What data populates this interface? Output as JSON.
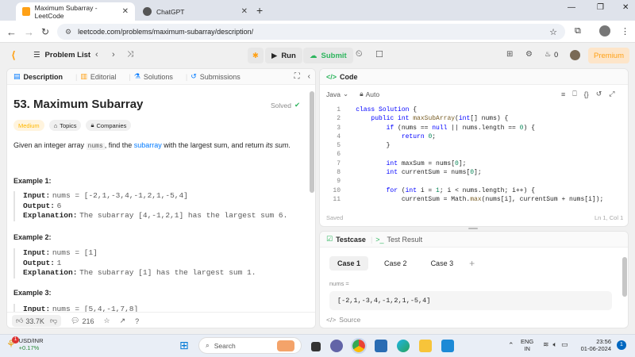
{
  "browser": {
    "tabs": [
      {
        "title": "Maximum Subarray - LeetCode",
        "active": true
      },
      {
        "title": "ChatGPT",
        "active": false
      }
    ],
    "url": "leetcode.com/problems/maximum-subarray/description/"
  },
  "nav": {
    "problem_list": "Problem List",
    "run": "Run",
    "submit": "Submit",
    "count": "0",
    "premium": "Premium"
  },
  "left_tabs": [
    "Description",
    "Editorial",
    "Solutions",
    "Submissions"
  ],
  "problem": {
    "title": "53. Maximum Subarray",
    "status": "Solved",
    "difficulty": "Medium",
    "topics": "Topics",
    "companies": "Companies",
    "desc_pre": "Given an integer array ",
    "desc_code": "nums",
    "desc_mid": ", find the ",
    "desc_link": "subarray",
    "desc_post": " with the largest sum, and return ",
    "desc_em": "its sum",
    "desc_end": "."
  },
  "examples": [
    {
      "heading": "Example 1:",
      "input": "nums = [-2,1,-3,4,-1,2,1,-5,4]",
      "output": "6",
      "explanation": "The subarray [4,-1,2,1] has the largest sum 6."
    },
    {
      "heading": "Example 2:",
      "input": "nums = [1]",
      "output": "1",
      "explanation": "The subarray [1] has the largest sum 1."
    },
    {
      "heading": "Example 3:",
      "input": "nums = [5,4,-1,7,8]"
    }
  ],
  "labels": {
    "input": "Input:",
    "output": "Output:",
    "explanation": "Explanation:"
  },
  "stats": {
    "likes": "33.7K",
    "comments": "216"
  },
  "code": {
    "header": "Code",
    "language": "Java",
    "mode": "Auto",
    "saved": "Saved",
    "cursor": "Ln 1, Col 1",
    "lines": [
      "1",
      "2",
      "3",
      "4",
      "5",
      "6",
      "7",
      "8",
      "9",
      "10",
      "11"
    ]
  },
  "testcase": {
    "tab": "Testcase",
    "result": "Test Result",
    "cases": [
      "Case 1",
      "Case 2",
      "Case 3"
    ],
    "param": "nums =",
    "value": "[-2,1,-3,4,-1,2,1,-5,4]",
    "source": "Source"
  },
  "taskbar": {
    "ticker": "USD/INR",
    "change": "+0.17%",
    "badge": "1",
    "search": "Search",
    "lang1": "ENG",
    "lang2": "IN",
    "time": "23:56",
    "date": "01-06-2024",
    "notif": "1"
  },
  "colors": {
    "brand": "#ffa116",
    "green": "#2db55d",
    "link": "#007aff"
  }
}
